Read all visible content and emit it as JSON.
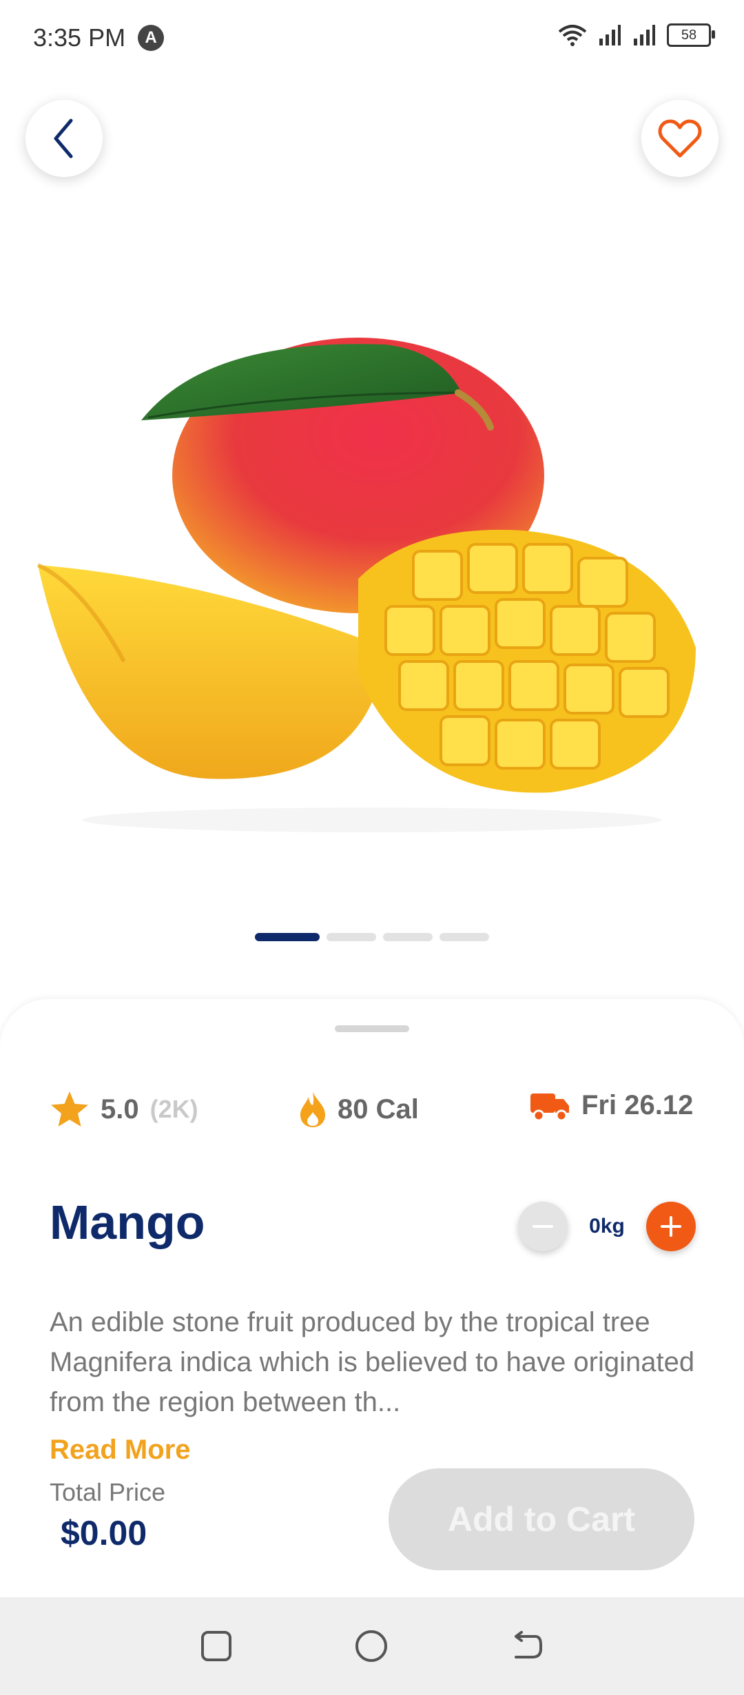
{
  "status_bar": {
    "time": "3:35 PM",
    "badge": "A",
    "battery": "58"
  },
  "product": {
    "name": "Mango",
    "description": "An edible stone fruit produced by the tropical tree Magnifera indica which is believed to have originated from the region between th...",
    "read_more": "Read More",
    "rating": "5.0",
    "reviews": "(2K)",
    "calories": "80 Cal",
    "delivery": "Fri 26.12",
    "quantity": "0kg"
  },
  "pricing": {
    "label": "Total Price",
    "total": "$0.00",
    "add_to_cart": "Add to Cart"
  },
  "carousel": {
    "active_index": 0,
    "count": 4
  },
  "icons": {
    "back": "chevron-left-icon",
    "favorite": "heart-outline-icon",
    "rating": "star-icon",
    "calories": "flame-icon",
    "delivery": "truck-icon",
    "minus": "minus-icon",
    "plus": "plus-icon"
  },
  "colors": {
    "primary": "#0f2a6b",
    "accent": "#f05a14",
    "rating": "#f2a21c",
    "disabled": "#dcdcdc"
  }
}
